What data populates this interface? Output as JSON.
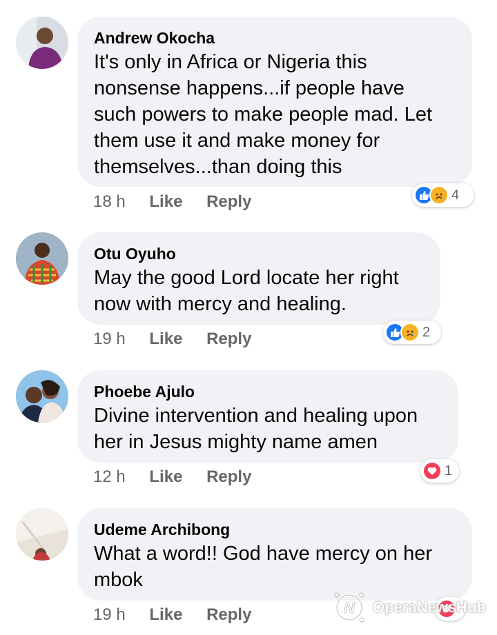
{
  "comments": [
    {
      "author": "Andrew Okocha",
      "text": "It's only in Africa or Nigeria this\nnonsense happens...if people have\nsuch powers to make people mad. Let\nthem use it and make money for\nthemselves...than doing this",
      "time": "18 h",
      "like_label": "Like",
      "reply_label": "Reply",
      "reactions": [
        "like-icon",
        "sad-icon"
      ],
      "reaction_count": "4"
    },
    {
      "author": "Otu Oyuho",
      "text": "May the good Lord locate her right\nnow with mercy and healing.",
      "time": "19 h",
      "like_label": "Like",
      "reply_label": "Reply",
      "reactions": [
        "like-icon",
        "sad-icon"
      ],
      "reaction_count": "2"
    },
    {
      "author": "Phoebe Ajulo",
      "text": "Divine intervention and healing upon\nher in Jesus mighty name amen",
      "time": "12 h",
      "like_label": "Like",
      "reply_label": "Reply",
      "reactions": [
        "love-icon"
      ],
      "reaction_count": "1"
    },
    {
      "author": "Udeme Archibong",
      "text": "What a word!! God have mercy on her\nmbok",
      "time": "19 h",
      "like_label": "Like",
      "reply_label": "Reply",
      "reactions": [
        "love-icon"
      ],
      "reaction_count": ""
    }
  ],
  "watermark": {
    "text": "OperaNewsHub"
  },
  "colors": {
    "bubble": "#f0f2f5",
    "like": "#1877f2",
    "sad": "#f7b125",
    "love": "#f33e58",
    "meta": "#65676b"
  }
}
